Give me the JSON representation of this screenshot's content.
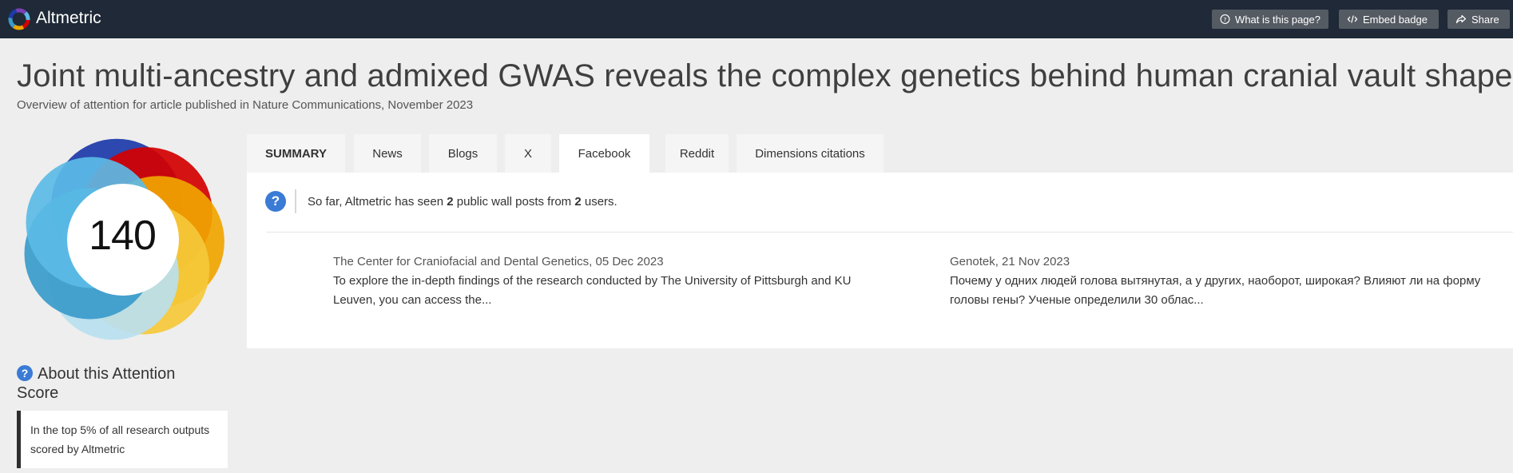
{
  "header": {
    "brand": "Altmetric",
    "buttons": [
      {
        "label": "What is this page?",
        "icon": "question-circle-icon"
      },
      {
        "label": "Embed badge",
        "icon": "code-icon"
      },
      {
        "label": "Share",
        "icon": "share-icon"
      }
    ]
  },
  "article": {
    "title": "Joint multi-ancestry and admixed GWAS reveals the complex genetics behind human cranial vault shape",
    "subtitle": "Overview of attention for article published in Nature Communications, November 2023"
  },
  "score": {
    "value": "140",
    "colors": [
      "#1c3aa9",
      "#d40000",
      "#f0a500",
      "#f5c83a",
      "#b9e0ef",
      "#3a9bcb",
      "#5bbbe6"
    ]
  },
  "about": {
    "title": "About this Attention Score",
    "text": "In the top 5% of all research outputs scored by Altmetric"
  },
  "tabs": [
    {
      "label": "SUMMARY",
      "active": false
    },
    {
      "label": "News",
      "active": false
    },
    {
      "label": "Blogs",
      "active": false
    },
    {
      "label": "X",
      "active": false
    },
    {
      "label": "Facebook",
      "active": true
    },
    {
      "label": "Reddit",
      "active": false
    },
    {
      "label": "Dimensions citations",
      "active": false
    }
  ],
  "facebook": {
    "summary_prefix": "So far, Altmetric has seen ",
    "posts_count": "2",
    "summary_middle": " public wall posts from ",
    "users_count": "2",
    "summary_suffix": " users.",
    "posts": [
      {
        "meta": "The Center for Craniofacial and Dental Genetics, 05 Dec 2023",
        "line1": "To explore the in-depth findings of the research conducted by The University of Pittsburgh and KU",
        "line2": "Leuven, you can access the..."
      },
      {
        "meta": "Genotek, 21 Nov 2023",
        "line1": "Почему у одних людей голова вытянутая, а у других, наоборот, широкая? Влияют ли на форму",
        "line2": "головы гены? Ученые определили 30 облас..."
      }
    ]
  }
}
